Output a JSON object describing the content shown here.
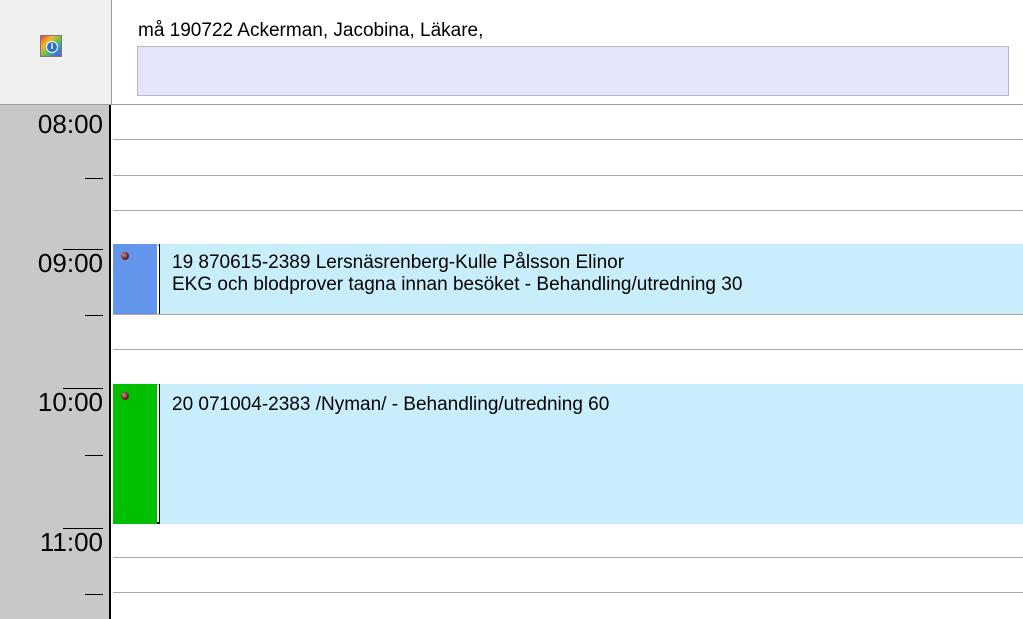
{
  "header": {
    "title": "må 190722 Ackerman, Jacobina, Läkare,",
    "info_icon": "info-icon"
  },
  "time_labels": [
    "08:00",
    "09:00",
    "10:00",
    "11:00"
  ],
  "appointments": [
    {
      "line1": "19 870615-2389  Lersnäsrenberg-Kulle Pålsson Elinor",
      "line2": "EKG och blodprover tagna innan besöket - Behandling/utredning 30",
      "status_color": "#6495ed"
    },
    {
      "line1": "20 071004-2383  /Nyman/ - Behandling/utredning 60",
      "line2": "",
      "status_color": "#00bf00"
    }
  ],
  "colors": {
    "gutter": "#c8c8c8",
    "appointment_body": "#c8eefc",
    "header_field": "#e6e6fb"
  }
}
